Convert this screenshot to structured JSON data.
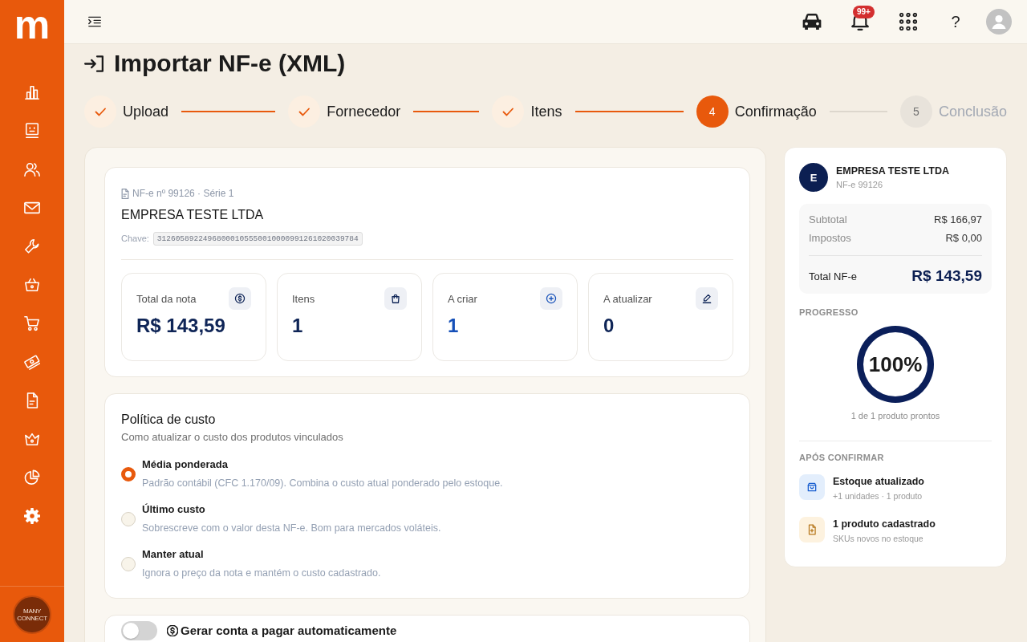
{
  "sidebar": {
    "logo": "m",
    "brand": "MANY CONNECT"
  },
  "topbar": {
    "badge": "99+",
    "help": "?"
  },
  "page": {
    "title": "Importar NF-e (XML)"
  },
  "stepper": [
    {
      "label": "Upload",
      "done": true,
      "selected": false
    },
    {
      "label": "Fornecedor",
      "done": true,
      "selected": false
    },
    {
      "label": "Itens",
      "done": true,
      "selected": false
    },
    {
      "number": "4",
      "label": "Confirmação",
      "done": false,
      "selected": true
    },
    {
      "number": "5",
      "label": "Conclusão",
      "done": false,
      "selected": false
    }
  ],
  "invoice": {
    "meta": "NF-e nº 99126 · Série 1",
    "company": "EMPRESA TESTE LTDA",
    "key_label": "Chave:",
    "key": "31260589224968000105550010000991261020039784",
    "stats": [
      {
        "kind": "total",
        "label": "Total da nota",
        "value": "R$ 143,59",
        "color": "#0f2557"
      },
      {
        "kind": "items",
        "label": "Itens",
        "value": "1",
        "color": "#0f2557"
      },
      {
        "kind": "create",
        "label": "A criar",
        "value": "1",
        "color": "#1550b8"
      },
      {
        "kind": "update",
        "label": "A atualizar",
        "value": "0",
        "color": "#0f2557"
      }
    ]
  },
  "cost_policy": {
    "title": "Política de custo",
    "subtitle": "Como atualizar o custo dos produtos vinculados",
    "options": [
      {
        "label": "Média ponderada",
        "description": "Padrão contábil (CFC 1.170/09). Combina o custo atual ponderado pelo estoque.",
        "selected": true
      },
      {
        "label": "Último custo",
        "description": "Sobrescreve com o valor desta NF-e. Bom para mercados voláteis.",
        "selected": false
      },
      {
        "label": "Manter atual",
        "description": "Ignora o preço da nota e mantém o custo cadastrado.",
        "selected": false
      }
    ]
  },
  "payable": {
    "label": "Gerar conta a pagar automaticamente",
    "on": false
  },
  "summary": {
    "avatar": "E",
    "company": "EMPRESA TESTE LTDA",
    "subtitle": "NF-e 99126",
    "rows": [
      {
        "label": "Subtotal",
        "value": "R$ 166,97"
      },
      {
        "label": "Impostos",
        "value": "R$ 0,00"
      }
    ],
    "total": {
      "label": "Total NF-e",
      "value": "R$ 143,59"
    },
    "progress": {
      "heading": "PROGRESSO",
      "level": 1,
      "percent": "100%",
      "caption": "1 de 1 produto prontos"
    },
    "after": {
      "heading": "APÓS CONFIRMAR",
      "items": [
        {
          "kind": "stock",
          "title": "Estoque atualizado",
          "detail": "+1 unidades · 1 produto"
        },
        {
          "kind": "product",
          "title": "1 produto cadastrado",
          "detail": "SKUs novos no estoque"
        }
      ]
    }
  }
}
